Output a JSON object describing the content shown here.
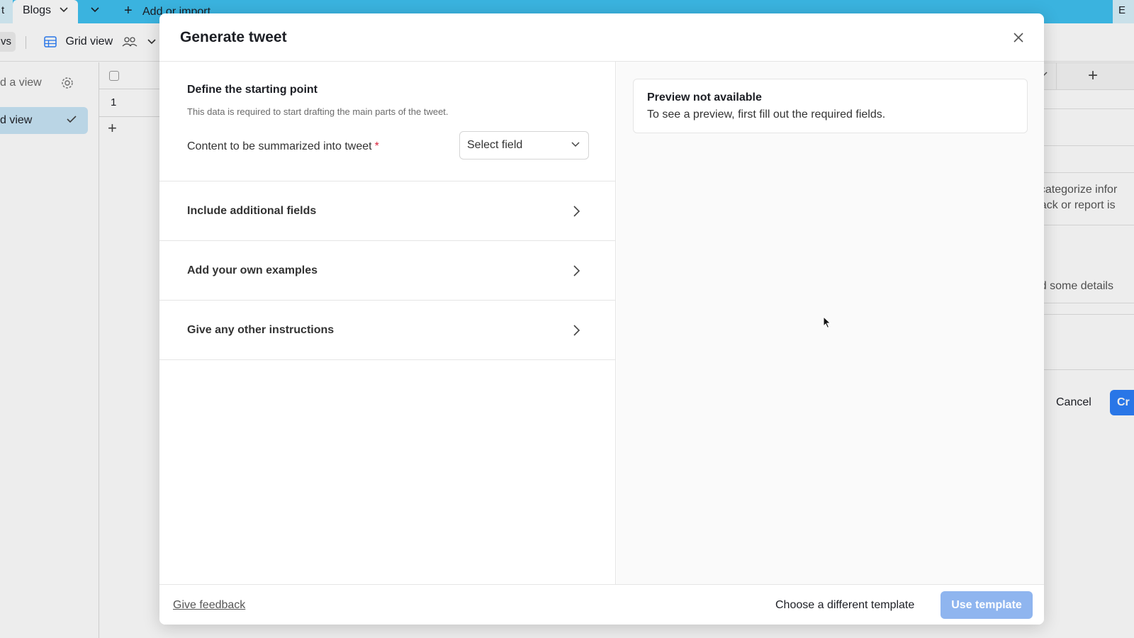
{
  "background_app": {
    "tab_left_fragment": "t",
    "tab_active_label": "Blogs",
    "add_import_label": "Add or import",
    "tab_right_fragment": "E",
    "views_fragment": "vs",
    "grid_view_label": "Grid view",
    "find_view_fragment": "d a view",
    "grid_item_fragment": "d view",
    "row_number": "1",
    "under_dialog": {
      "text1": "s, categorize infor",
      "text2": "dback or report is",
      "text3": "add some details",
      "cancel_label": "Cancel",
      "create_fragment": "Cr"
    }
  },
  "modal": {
    "title": "Generate tweet",
    "start_section": {
      "title": "Define the starting point",
      "description": "This data is required to start drafting the main parts of the tweet.",
      "field_label": "Content to be summarized into tweet",
      "required_mark": "*",
      "select_placeholder": "Select field"
    },
    "accordions": [
      {
        "label": "Include additional fields"
      },
      {
        "label": "Add your own examples"
      },
      {
        "label": "Give any other instructions"
      }
    ],
    "preview": {
      "title": "Preview not available",
      "text": "To see a preview, first fill out the required fields."
    },
    "footer": {
      "feedback_label": "Give feedback",
      "choose_label": "Choose a different template",
      "use_label": "Use template"
    }
  },
  "colors": {
    "topbar": "#3fc1f0",
    "primary_disabled": "#8fb5ef",
    "required": "#d9243c",
    "selected_view": "#c9e6f7"
  }
}
